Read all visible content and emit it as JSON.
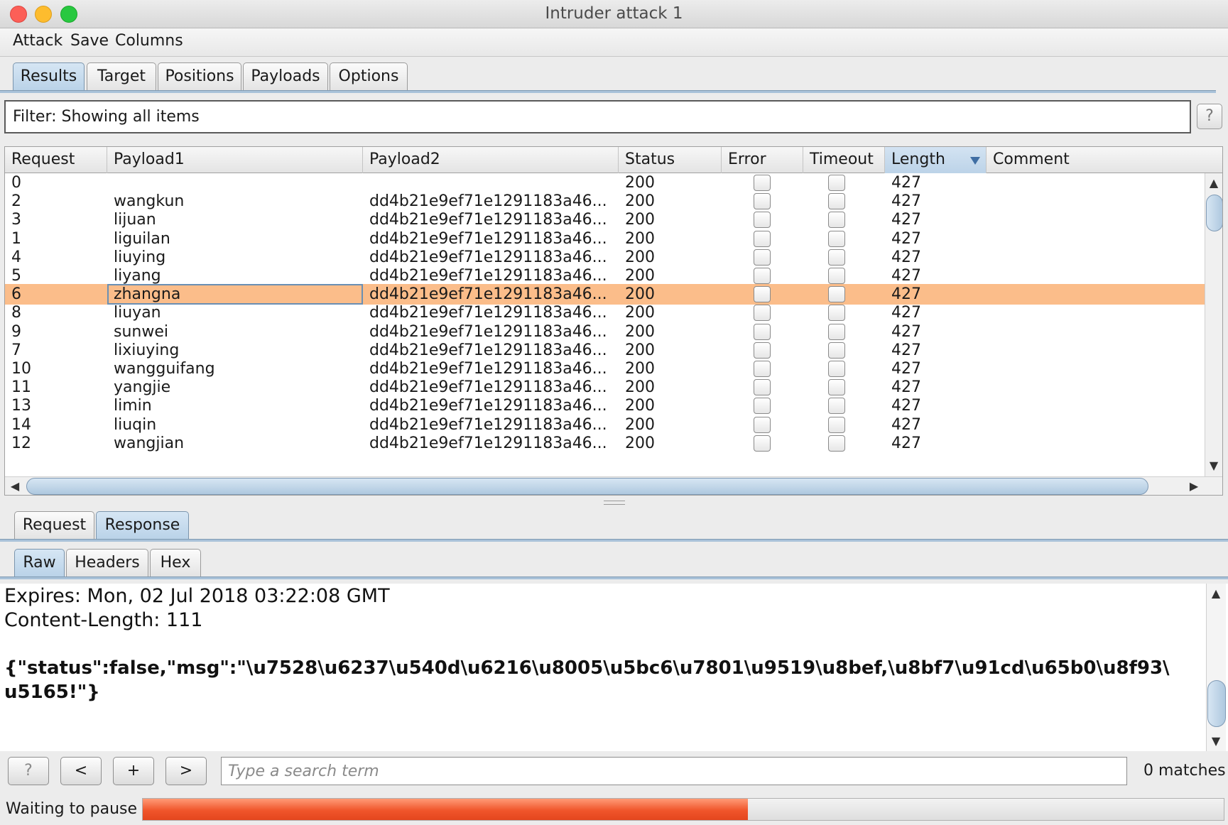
{
  "window": {
    "title": "Intruder attack 1"
  },
  "menu": [
    "Attack",
    "Save",
    "Columns"
  ],
  "tabs": [
    "Results",
    "Target",
    "Positions",
    "Payloads",
    "Options"
  ],
  "active_tab": "Results",
  "filter": {
    "label": "Filter: Showing all items",
    "help": "?"
  },
  "table": {
    "columns": [
      "Request",
      "Payload1",
      "Payload2",
      "Status",
      "Error",
      "Timeout",
      "Length",
      "Comment"
    ],
    "sorted_column": "Length",
    "rows": [
      {
        "request": "0",
        "payload1": "",
        "payload2": "",
        "status": "200",
        "length": "427"
      },
      {
        "request": "2",
        "payload1": "wangkun",
        "payload2": "dd4b21e9ef71e1291183a46...",
        "status": "200",
        "length": "427"
      },
      {
        "request": "3",
        "payload1": "lijuan",
        "payload2": "dd4b21e9ef71e1291183a46...",
        "status": "200",
        "length": "427"
      },
      {
        "request": "1",
        "payload1": "liguilan",
        "payload2": "dd4b21e9ef71e1291183a46...",
        "status": "200",
        "length": "427"
      },
      {
        "request": "4",
        "payload1": "liuying",
        "payload2": "dd4b21e9ef71e1291183a46...",
        "status": "200",
        "length": "427"
      },
      {
        "request": "5",
        "payload1": "liyang",
        "payload2": "dd4b21e9ef71e1291183a46...",
        "status": "200",
        "length": "427"
      },
      {
        "request": "6",
        "payload1": "zhangna",
        "payload2": "dd4b21e9ef71e1291183a46...",
        "status": "200",
        "length": "427"
      },
      {
        "request": "8",
        "payload1": "liuyan",
        "payload2": "dd4b21e9ef71e1291183a46...",
        "status": "200",
        "length": "427"
      },
      {
        "request": "9",
        "payload1": "sunwei",
        "payload2": "dd4b21e9ef71e1291183a46...",
        "status": "200",
        "length": "427"
      },
      {
        "request": "7",
        "payload1": "lixiuying",
        "payload2": "dd4b21e9ef71e1291183a46...",
        "status": "200",
        "length": "427"
      },
      {
        "request": "10",
        "payload1": "wangguifang",
        "payload2": "dd4b21e9ef71e1291183a46...",
        "status": "200",
        "length": "427"
      },
      {
        "request": "11",
        "payload1": "yangjie",
        "payload2": "dd4b21e9ef71e1291183a46...",
        "status": "200",
        "length": "427"
      },
      {
        "request": "13",
        "payload1": "limin",
        "payload2": "dd4b21e9ef71e1291183a46...",
        "status": "200",
        "length": "427"
      },
      {
        "request": "14",
        "payload1": "liuqin",
        "payload2": "dd4b21e9ef71e1291183a46...",
        "status": "200",
        "length": "427"
      },
      {
        "request": "12",
        "payload1": "wangjian",
        "payload2": "dd4b21e9ef71e1291183a46...",
        "status": "200",
        "length": "427"
      }
    ],
    "selected_request": "6",
    "selection_color": "#fbbd8a"
  },
  "message_tabs": [
    "Request",
    "Response"
  ],
  "active_message_tab": "Response",
  "view_tabs": [
    "Raw",
    "Headers",
    "Hex"
  ],
  "active_view_tab": "Raw",
  "response_lines": [
    "Expires: Mon, 02 Jul 2018 03:22:08 GMT",
    "Content-Length: 111",
    "",
    "{\"status\":false,\"msg\":\"\\u7528\\u6237\\u540d\\u6216\\u8005\\u5bc6\\u7801\\u9519\\u8bef,\\u8bf7\\u91cd\\u65b0\\u8f93\\",
    "u5165!\"}"
  ],
  "search": {
    "help": "?",
    "prev": "<",
    "add": "+",
    "next": ">",
    "placeholder": "Type a search term",
    "matches": "0 matches"
  },
  "status": {
    "text": "Waiting to pause",
    "progress_percent": 56,
    "progress_color": "#f0552b"
  }
}
